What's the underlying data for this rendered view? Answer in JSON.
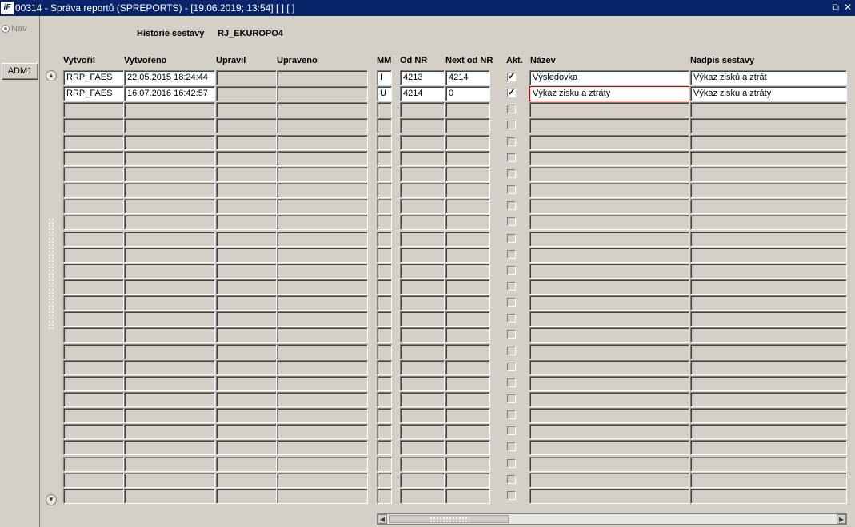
{
  "window": {
    "icon": "iF",
    "title": "00314 - Správa reportů (SPREPORTS) - [19.06.2019; 13:54]  [ ]  [ ]",
    "restore_icon": "⧉",
    "close_icon": "✕"
  },
  "left": {
    "nav_label": "Nav",
    "adm_button": "ADM1"
  },
  "header": {
    "history_label": "Historie sestavy",
    "history_value": "RJ_EKUROPO4"
  },
  "columns": {
    "vytvoril": "Vytvořil",
    "vytvoreno": "Vytvořeno",
    "upravil": "Upravil",
    "upraveno": "Upraveno",
    "mm": "MM",
    "od_nr": "Od NR",
    "next_od_nr": "Next od NR",
    "akt": "Akt.",
    "nazev": "Název",
    "nadpis": "Nadpis sestavy"
  },
  "rows": [
    {
      "vytvoril": "RRP_FAES",
      "vytvoreno": "22.05.2015 18:24:44",
      "upravil": "",
      "upraveno": "",
      "mm": "I",
      "od_nr": "4213",
      "next_od_nr": "4214",
      "akt": true,
      "nazev": "Výsledovka",
      "nadpis": "Výkaz zisků a ztrát"
    },
    {
      "vytvoril": "RRP_FAES",
      "vytvoreno": "16.07.2016 16:42:57",
      "upravil": "",
      "upraveno": "",
      "mm": "U",
      "od_nr": "4214",
      "next_od_nr": "0",
      "akt": true,
      "nazev": "Výkaz zisku a ztráty",
      "nadpis": "Výkaz zisku a ztráty"
    }
  ],
  "empty_row_count": 25,
  "focused_row": 1,
  "focused_column": "nazev",
  "scroll": {
    "up_icon": "▲",
    "down_icon": "▼",
    "left_icon": "◀",
    "right_icon": "▶"
  },
  "colors": {
    "titlebar": "#0a246a",
    "focus_border": "#c00000",
    "face": "#d4d0c8"
  }
}
